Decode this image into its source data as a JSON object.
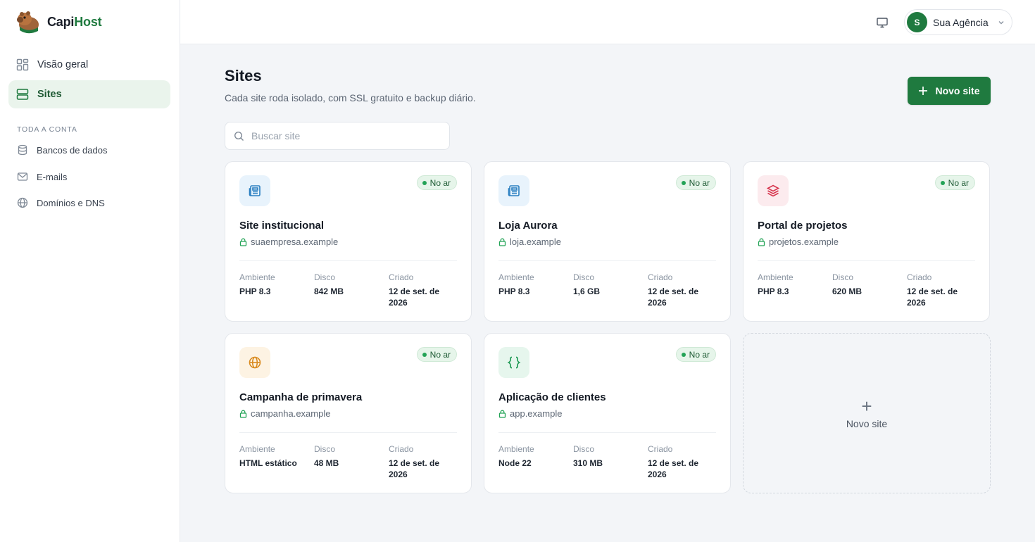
{
  "brand": {
    "name_part1": "Capi",
    "name_part2": "Host",
    "logo_icon": "capybara-logo"
  },
  "sidebar": {
    "main_items": [
      {
        "label": "Visão geral",
        "icon": "grid-icon",
        "active": false
      },
      {
        "label": "Sites",
        "icon": "server-icon",
        "active": true
      }
    ],
    "section_label": "TODA A CONTA",
    "account_items": [
      {
        "label": "Bancos de dados",
        "icon": "database-icon"
      },
      {
        "label": "E-mails",
        "icon": "mail-icon"
      },
      {
        "label": "Domínios e DNS",
        "icon": "globe-icon"
      }
    ]
  },
  "topbar": {
    "monitor_icon": "monitor-icon",
    "account": {
      "initial": "S",
      "name": "Sua Agência"
    }
  },
  "page": {
    "title": "Sites",
    "subtitle": "Cada site roda isolado, com SSL gratuito e backup diário.",
    "new_button": "Novo site",
    "search_placeholder": "Buscar site"
  },
  "meta_labels": {
    "env": "Ambiente",
    "disk": "Disco",
    "created": "Criado"
  },
  "sites": [
    {
      "name": "Site institucional",
      "domain": "suaempresa.example",
      "status": "No ar",
      "env": "PHP 8.3",
      "disk": "842 MB",
      "created": "12 de set. de 2026",
      "icon": "newspaper-icon",
      "icon_color": "#2a7fc1",
      "icon_bg": "#e8f3fc"
    },
    {
      "name": "Loja Aurora",
      "domain": "loja.example",
      "status": "No ar",
      "env": "PHP 8.3",
      "disk": "1,6 GB",
      "created": "12 de set. de 2026",
      "icon": "newspaper-icon",
      "icon_color": "#2a7fc1",
      "icon_bg": "#e8f3fc"
    },
    {
      "name": "Portal de projetos",
      "domain": "projetos.example",
      "status": "No ar",
      "env": "PHP 8.3",
      "disk": "620 MB",
      "created": "12 de set. de 2026",
      "icon": "layers-icon",
      "icon_color": "#d7374f",
      "icon_bg": "#fcebee"
    },
    {
      "name": "Campanha de primavera",
      "domain": "campanha.example",
      "status": "No ar",
      "env": "HTML estático",
      "disk": "48 MB",
      "created": "12 de set. de 2026",
      "icon": "globe-icon",
      "icon_color": "#d98a1e",
      "icon_bg": "#fdf3e3"
    },
    {
      "name": "Aplicação de clientes",
      "domain": "app.example",
      "status": "No ar",
      "env": "Node 22",
      "disk": "310 MB",
      "created": "12 de set. de 2026",
      "icon": "braces-icon",
      "icon_color": "#1f9a55",
      "icon_bg": "#e6f6ed"
    }
  ],
  "add_card": {
    "label": "Novo site"
  },
  "colors": {
    "accent": "#1f7a3f",
    "status_dot": "#23a356"
  }
}
